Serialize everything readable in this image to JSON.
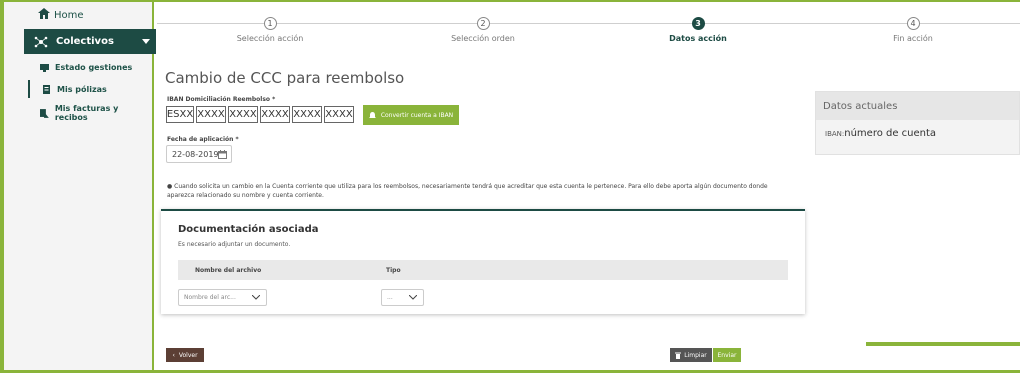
{
  "sidebar": {
    "home": "Home",
    "colectivos": "Colectivos",
    "items": [
      {
        "label": "Estado gestiones"
      },
      {
        "label": "Mis pólizas"
      },
      {
        "label": "Mis facturas y recibos"
      }
    ]
  },
  "stepper": {
    "steps": [
      {
        "num": "1",
        "label": "Selección acción"
      },
      {
        "num": "2",
        "label": "Selección orden"
      },
      {
        "num": "3",
        "label": "Datos acción"
      },
      {
        "num": "4",
        "label": "Fin acción"
      }
    ],
    "current_step": "3"
  },
  "main": {
    "title": "Cambio de CCC para reembolso",
    "iban_label": "IBAN Domiciliación Reembolso *",
    "iban_parts": [
      "ESXX",
      "XXXX",
      "XXXX",
      "XXXX",
      "XXXX",
      "XXXX"
    ],
    "convert_button": "Convertir cuenta a IBAN",
    "date_label": "Fecha de aplicación *",
    "date_value": "22-08-2019",
    "info_text": "Cuando solicita un cambio en la Cuenta corriente que utiliza para los reembolsos, necesariamente tendrá que acreditar que esta cuenta le pertenece. Para ello debe aporta algún documento donde aparezca relacionado su nombre y cuenta corriente."
  },
  "documents": {
    "title": "Documentación asociada",
    "subtitle": "Es necesario adjuntar un documento.",
    "col_file": "Nombre del archivo",
    "col_type": "Tipo",
    "file_select": "Nombre del arc...",
    "type_select": "..."
  },
  "panel": {
    "title": "Datos actuales",
    "iban_key": "IBAN:",
    "iban_value": "número de cuenta"
  },
  "footer": {
    "back": "Volver",
    "clear": "Limpiar",
    "send": "Enviar"
  },
  "colors": {
    "accent_green": "#8ab43a",
    "dark_teal": "#1d4b44",
    "back_brown": "#5c3f35"
  }
}
